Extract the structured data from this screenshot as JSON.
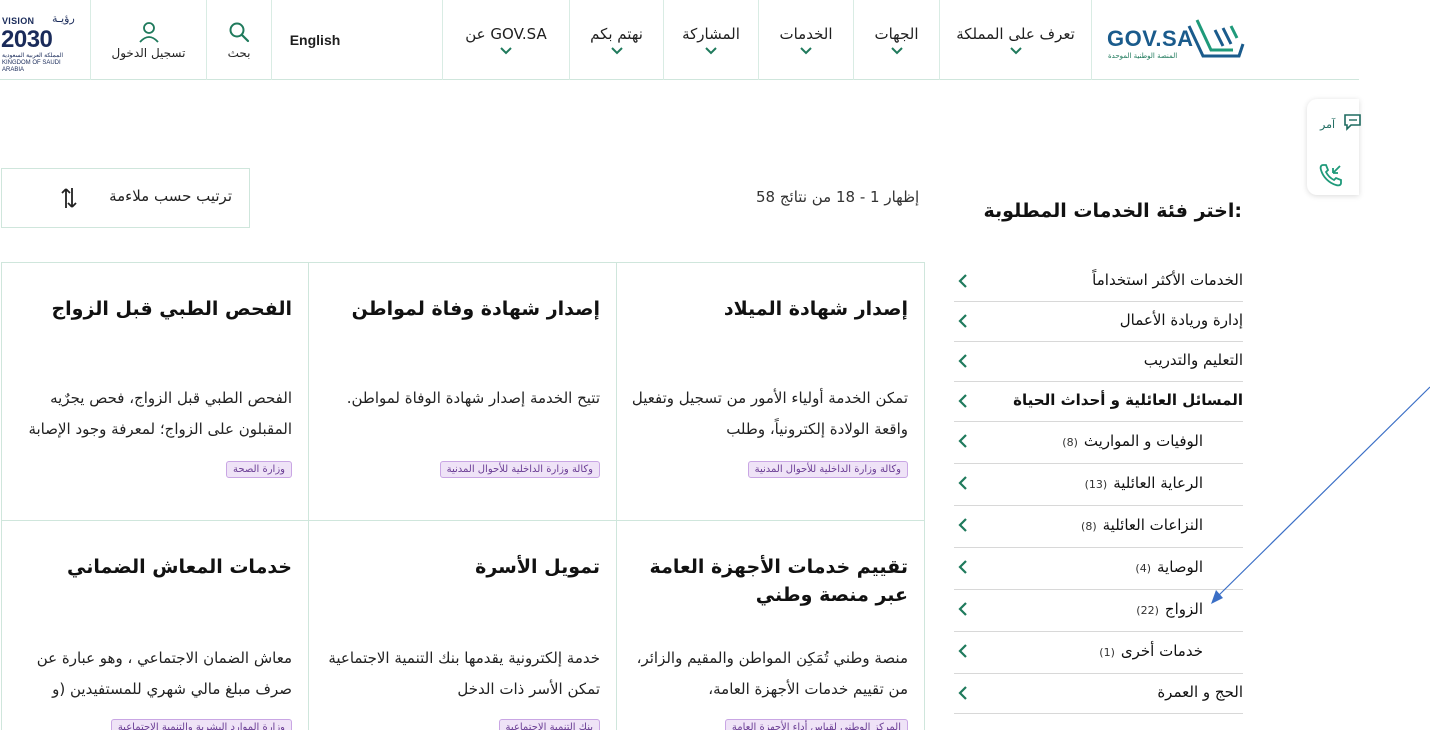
{
  "header": {
    "vision": {
      "top": "VISION",
      "ar": "رؤيـة",
      "num": "2030",
      "sub": "المملكة العربية السعودية KINGDOM OF SAUDI ARABIA"
    },
    "login_label": "تسجيل الدخول",
    "search_label": "بحث",
    "lang_label": "English",
    "nav": [
      {
        "label": "عن GOV.SA"
      },
      {
        "label": "نهتم بكم"
      },
      {
        "label": "المشاركة"
      },
      {
        "label": "الخدمات"
      },
      {
        "label": "الجهات"
      },
      {
        "label": "تعرف على المملكة"
      }
    ],
    "logo": {
      "text": "GOV.SA",
      "sub": "المنصة الوطنية الموحدة"
    }
  },
  "sidetab": {
    "label": "آمر"
  },
  "sort": {
    "label": "ترتيب حسب  ملاءمة"
  },
  "results": {
    "text": "إظهار 1 - 18 من نتائج 58"
  },
  "categories": {
    "title": "اختر فئة الخدمات المطلوبة:",
    "items": [
      {
        "label": "الخدمات الأكثر استخداماً",
        "count": ""
      },
      {
        "label": "إدارة وريادة الأعمال",
        "count": ""
      },
      {
        "label": "التعليم والتدريب",
        "count": ""
      },
      {
        "label": "المسائل العائلية و أحداث الحياة",
        "count": ""
      },
      {
        "label": "الوفيات و المواريث",
        "count": "(8)"
      },
      {
        "label": "الرعاية العائلية",
        "count": "(13)"
      },
      {
        "label": "النزاعات العائلية",
        "count": "(8)"
      },
      {
        "label": "الوصاية",
        "count": "(4)"
      },
      {
        "label": "الزواج",
        "count": "(22)"
      },
      {
        "label": "خدمات أخرى",
        "count": "(1)"
      },
      {
        "label": "الحج و العمرة",
        "count": ""
      }
    ]
  },
  "cards": [
    {
      "title": "إصدار شهادة الميلاد",
      "desc": "تمكن الخدمة أولياء الأمور من تسجيل وتفعيل واقعة الولادة إلكترونياً، وطلب",
      "agency": "وكالة وزارة الداخلية للأحوال المدنية"
    },
    {
      "title": "إصدار شهادة وفاة لمواطن",
      "desc": "تتيح الخدمة إصدار شهادة الوفاة لمواطن.",
      "agency": "وكالة وزارة الداخلية للأحوال المدنية"
    },
    {
      "title": "الفحص الطبي قبل الزواج",
      "desc": "الفحص الطبي قبل الزواج، فحص يجرٌيه المقبلون على الزواج؛ لمعرفة وجود الإصابة",
      "agency": "وزارة الصحة"
    },
    {
      "title": "تقييم خدمات الأجهزة العامة عبر منصة وطني",
      "desc": "منصة وطني تُمَكِن المواطن والمقيم والزائر، من تقييم خدمات الأجهزة العامة،",
      "agency": "المركز الوطني لقياس أداء الأجهزة العامة"
    },
    {
      "title": "تمويل الأسرة",
      "desc": "خدمة إلكترونية يقدمها بنك التنمية الاجتماعية تمكن الأسر ذات الدخل",
      "agency": "بنك التنمية الاجتماعية"
    },
    {
      "title": "خدمات المعاش الضماني",
      "desc": "معاش الضمان الاجتماعي ، وهو عبارة عن صرف مبلغ مالي شهري للمستفيدين (و",
      "agency": "وزارة الموارد البشرية والتنمية الاجتماعية"
    }
  ],
  "colors": {
    "accent": "#1f7a5c",
    "border": "#cfe6dc",
    "badge_bg": "#efe3f7",
    "badge_text": "#6a3d94",
    "annotation": "#3b6fc6"
  }
}
